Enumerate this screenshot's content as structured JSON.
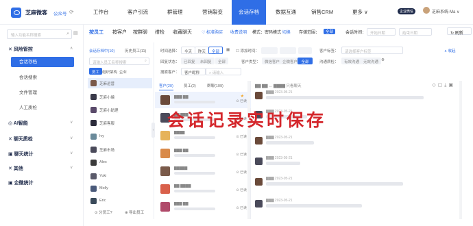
{
  "header": {
    "brand": "芝麻微客",
    "account_tag": "公众号",
    "nav": [
      "工作台",
      "客户引流",
      "群管理",
      "营销裂变",
      "会话存档",
      "数据互通",
      "销售CRM",
      "更多 ∨"
    ],
    "active_nav": "会话存档",
    "user_label": "芝麻系统-Ma ∨",
    "badge_text": "企业微信"
  },
  "sidebar": {
    "search_placeholder": "输入功能名称搜索",
    "groups": [
      {
        "label": "风险管控",
        "expanded": true,
        "items": [
          "会话存档",
          "会话搜索",
          "文件管理",
          "人工质检"
        ],
        "active_item": "会话存档"
      },
      {
        "label": "AI智能",
        "expanded": false
      },
      {
        "label": "聊天质检",
        "expanded": false
      },
      {
        "label": "聊天统计",
        "expanded": false
      },
      {
        "label": "其他",
        "expanded": false
      },
      {
        "label": "企微统计",
        "expanded": false
      }
    ]
  },
  "toolbar": {
    "tabs": [
      "按员工",
      "按客户",
      "按群聊",
      "搭检",
      "收藏聊天",
      "♡ 标准购买",
      "收费说明"
    ],
    "active_tab": "按员工",
    "mode_label": "模式：",
    "mode_value": "密码模式",
    "mode_switch": "切换",
    "storage_label": "存储范围：",
    "storage_value": "全部",
    "date_label": "会话时间：",
    "start_placeholder": "开始日期",
    "end_placeholder": "结束日期",
    "refresh_label": "刷新"
  },
  "employee_panel": {
    "tab_left": "会话存档中(10)",
    "tab_right": "历史员工(11)",
    "search_placeholder": "请输入员工名称搜索",
    "filters": [
      "员工",
      "组织架构",
      "企业"
    ],
    "active_filter": "员工",
    "employees": [
      "芝麻运营",
      "芝麻小编",
      "芝麻小助理",
      "芝麻客服",
      "Ivy",
      "芝麻市场",
      "Alex",
      "Yuki",
      "Molly",
      "Eric"
    ],
    "selected_index": 0,
    "bottom_left": "⊙ 分员工?",
    "bottom_right": "⊕ 导出员工"
  },
  "filter_panel": {
    "time_label": "时间选择：",
    "time_options": [
      "今天",
      "昨天",
      "全部"
    ],
    "time_active": "全部",
    "add_time_label": "添加时间：",
    "customer_tag_label": "客户标签：",
    "tag_placeholder": "请选择客户标签",
    "collapse_label": "∧ 收起",
    "source_label": "回复状态：",
    "source_options": [
      "已回复",
      "未回复",
      "全部"
    ],
    "type_label": "客户类型：",
    "type_options": [
      "微信客户",
      "企微客户",
      "全部"
    ],
    "type_active": "全部",
    "sort_label": "沟通质检：",
    "sort_options": [
      "有效沟通",
      "无效沟通"
    ],
    "search_type_label": "搜索客户：",
    "search_type_value": "客户昵称",
    "search_placeholder": "请输入"
  },
  "conversation_panel": {
    "tabs": [
      "客户(20)",
      "员工(2)",
      "群聊(109)"
    ],
    "active_tab": "客户(20)",
    "saved_label": "⊙ 已读",
    "rows": 8
  },
  "message_panel": {
    "toggle_label": "只看聊天",
    "tool_icons": [
      "tag-icon",
      "copy-icon",
      "download-icon",
      "export-icon"
    ]
  },
  "overlay_text": "会话记录实时保存",
  "colors": {
    "accent": "#2f6ee6",
    "overlay": "#d4262b"
  }
}
